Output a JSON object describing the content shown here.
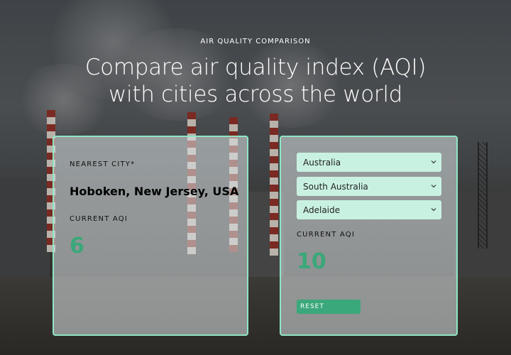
{
  "header": {
    "eyebrow": "AIR QUALITY COMPARISON",
    "headline_line1": "Compare air quality index (AQI)",
    "headline_line2": "with cities across the world"
  },
  "left_card": {
    "nearest_city_label": "NEAREST CITY*",
    "city": "Hoboken, New Jersey, USA",
    "aqi_label": "CURRENT AQI",
    "aqi_value": "6"
  },
  "right_card": {
    "country_select": "Australia",
    "state_select": "South Australia",
    "city_select": "Adelaide",
    "aqi_label": "CURRENT AQI",
    "aqi_value": "10",
    "reset_label": "RESET"
  },
  "colors": {
    "accent": "#3aa87a",
    "card_border": "#8ee6c4",
    "select_bg": "#c9f1e2"
  }
}
